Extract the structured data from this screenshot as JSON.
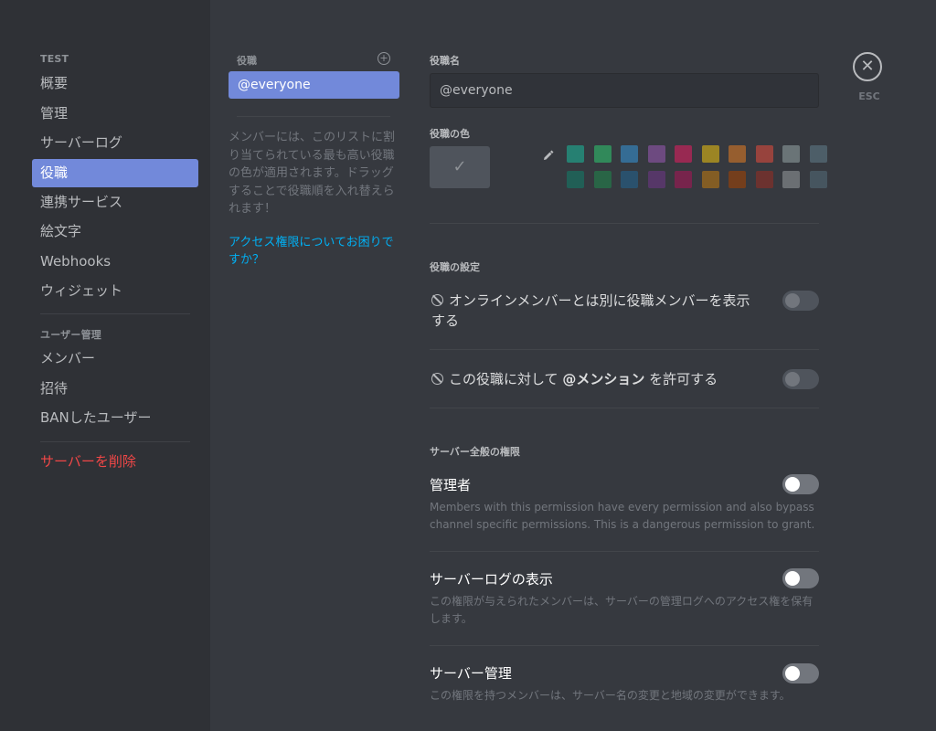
{
  "sidebar": {
    "server_header": "TEST",
    "server_items": [
      {
        "label": "概要"
      },
      {
        "label": "管理"
      },
      {
        "label": "サーバーログ"
      },
      {
        "label": "役職"
      },
      {
        "label": "連携サービス"
      },
      {
        "label": "絵文字"
      },
      {
        "label": "Webhooks"
      },
      {
        "label": "ウィジェット"
      }
    ],
    "user_header": "ユーザー管理",
    "user_items": [
      {
        "label": "メンバー"
      },
      {
        "label": "招待"
      },
      {
        "label": "BANしたユーザー"
      }
    ],
    "delete_label": "サーバーを削除"
  },
  "roles": {
    "header": "役職",
    "add_icon": "plus-circle-icon",
    "items": [
      {
        "label": "@everyone"
      }
    ],
    "description": "メンバーには、このリストに割り当てられている最も高い役職の色が適用されます。ドラッグすることで役職順を入れ替えられます！",
    "help_link": "アクセス権限についてお困りですか？"
  },
  "role_editor": {
    "name_label": "役職名",
    "name_value": "@everyone",
    "color_label": "役職の色",
    "swatches_row1": [
      "#1abc9c",
      "#2ecc71",
      "#3498db",
      "#9b59b6",
      "#e91e63",
      "#f1c40f",
      "#e67e22",
      "#e74c3c",
      "#95a5a6",
      "#607d8b"
    ],
    "swatches_row2": [
      "#11806a",
      "#1f8b4c",
      "#206694",
      "#71368a",
      "#ad1457",
      "#c27c0e",
      "#a84300",
      "#992d22",
      "#979c9f",
      "#546e7a"
    ],
    "settings_header": "役職の設定",
    "setting_hoist": "オンラインメンバーとは別に役職メンバーを表示する",
    "setting_mention_pre": "この役職に対して ",
    "setting_mention_bold": "@メンション",
    "setting_mention_post": " を許可する",
    "general_header": "サーバー全般の権限",
    "permissions": [
      {
        "title": "管理者",
        "description": "Members with this permission have every permission and also bypass channel specific permissions. This is a dangerous permission to grant."
      },
      {
        "title": "サーバーログの表示",
        "description": "この権限が与えられたメンバーは、サーバーの管理ログへのアクセス権を保有します。"
      },
      {
        "title": "サーバー管理",
        "description": "この権限を持つメンバーは、サーバー名の変更と地域の変更ができます。"
      }
    ]
  },
  "close": {
    "icon": "close-icon",
    "label": "ESC"
  }
}
